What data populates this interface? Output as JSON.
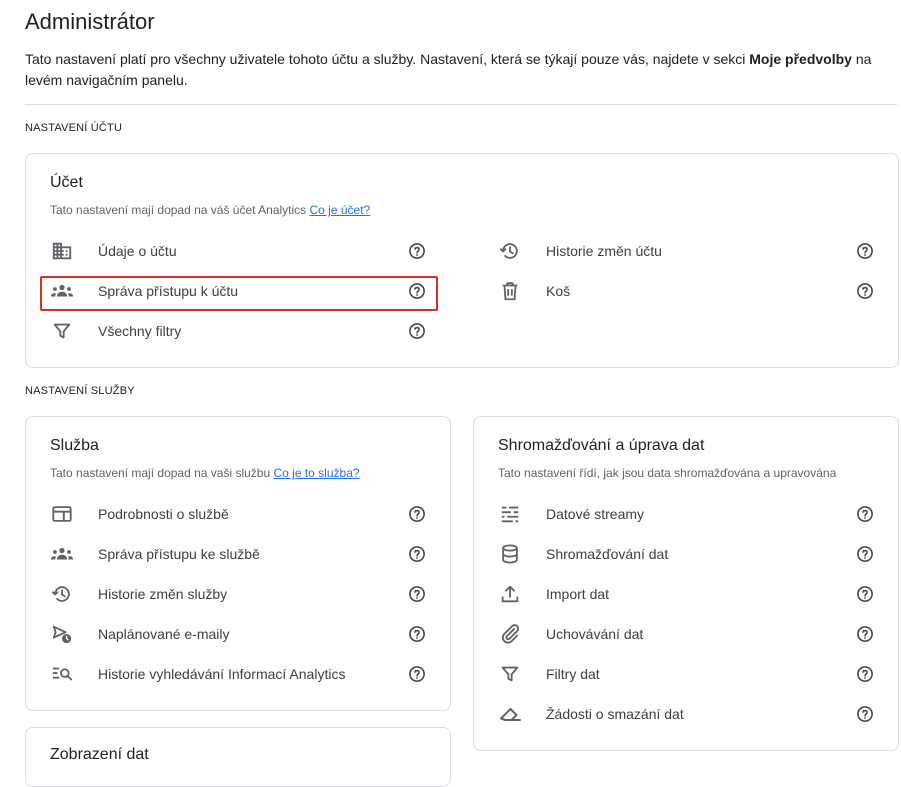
{
  "page": {
    "title": "Administrátor",
    "intro_before": "Tato nastavení platí pro všechny uživatele tohoto účtu a služby. Nastavení, která se týkají pouze vás, najdete v sekci ",
    "intro_bold": "Moje předvolby",
    "intro_after": " na levém navigačním panelu."
  },
  "account_section": {
    "label": "NASTAVENÍ ÚČTU",
    "card": {
      "title": "Účet",
      "desc": "Tato nastavení mají dopad na váš účet Analytics ",
      "desc_link": "Co je účet?",
      "items": [
        {
          "label": "Údaje o účtu",
          "icon": "building-icon"
        },
        {
          "label": "Správa přístupu k účtu",
          "icon": "people-icon",
          "highlighted": true
        },
        {
          "label": "Všechny filtry",
          "icon": "filter-icon"
        },
        {
          "label": "Historie změn účtu",
          "icon": "history-icon"
        },
        {
          "label": "Koš",
          "icon": "trash-icon"
        }
      ]
    }
  },
  "property_section": {
    "label": "NASTAVENÍ SLUŽBY",
    "property_card": {
      "title": "Služba",
      "desc": "Tato nastavení mají dopad na vaši službu ",
      "desc_link": "Co je to služba?",
      "items": [
        {
          "label": "Podrobnosti o službě",
          "icon": "property-details-icon"
        },
        {
          "label": "Správa přístupu ke službě",
          "icon": "people-icon"
        },
        {
          "label": "Historie změn služby",
          "icon": "history-icon"
        },
        {
          "label": "Naplánované e-maily",
          "icon": "scheduled-email-icon"
        },
        {
          "label": "Historie vyhledávání Informací Analytics",
          "icon": "search-history-icon"
        }
      ]
    },
    "data_card": {
      "title": "Shromažďování a úprava dat",
      "desc": "Tato nastavení řídí, jak jsou data shromažďována a upravována",
      "items": [
        {
          "label": "Datové streamy",
          "icon": "data-streams-icon"
        },
        {
          "label": "Shromažďování dat",
          "icon": "database-icon"
        },
        {
          "label": "Import dat",
          "icon": "upload-icon"
        },
        {
          "label": "Uchovávání dat",
          "icon": "attachment-icon"
        },
        {
          "label": "Filtry dat",
          "icon": "filter-icon"
        },
        {
          "label": "Žádosti o smazání dat",
          "icon": "eraser-icon"
        }
      ]
    },
    "display_card": {
      "title": "Zobrazení dat"
    }
  },
  "colors": {
    "border": "#dadce0",
    "link": "#1a73e8",
    "highlight": "#d93025",
    "icon": "#5f6368"
  }
}
